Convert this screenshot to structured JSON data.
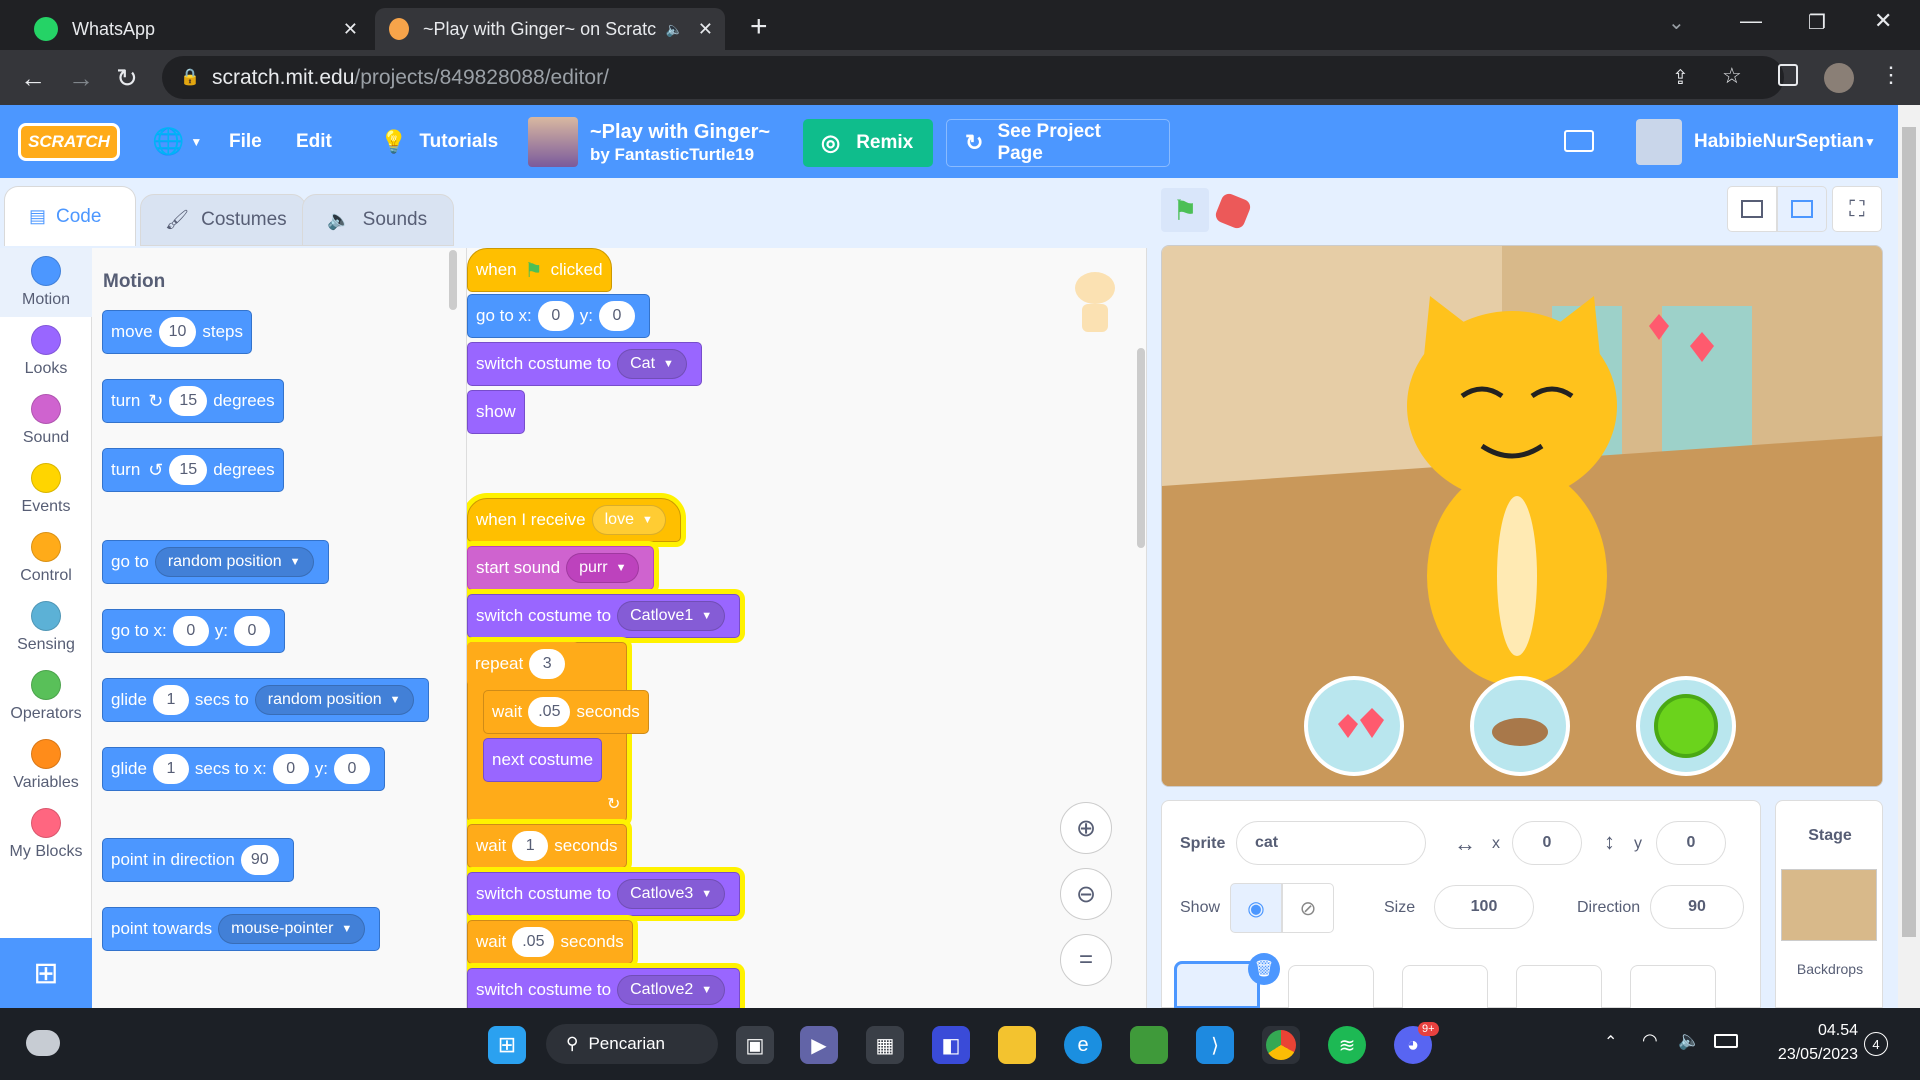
{
  "browser": {
    "tabs": [
      {
        "title": "WhatsApp",
        "icon": "whatsapp-icon"
      },
      {
        "title": "~Play with Ginger~ on Scratc",
        "icon": "scratch-icon"
      }
    ],
    "url_host": "scratch.mit.edu",
    "url_path": "/projects/849828088/editor/"
  },
  "menu": {
    "logo": "SCRATCH",
    "file": "File",
    "edit": "Edit",
    "tutorials": "Tutorials",
    "project_title": "~Play with Ginger~",
    "project_author": "by FantasticTurtle19",
    "remix": "Remix",
    "see_project_page": "See Project Page",
    "username": "HabibieNurSeptian"
  },
  "editor_tabs": {
    "code": "Code",
    "costumes": "Costumes",
    "sounds": "Sounds"
  },
  "categories": [
    {
      "label": "Motion",
      "color": "#4c97ff"
    },
    {
      "label": "Looks",
      "color": "#9966ff"
    },
    {
      "label": "Sound",
      "color": "#cf63cf"
    },
    {
      "label": "Events",
      "color": "#ffd500"
    },
    {
      "label": "Control",
      "color": "#ffab19"
    },
    {
      "label": "Sensing",
      "color": "#5cb1d6"
    },
    {
      "label": "Operators",
      "color": "#59c059"
    },
    {
      "label": "Variables",
      "color": "#ff8c1a"
    },
    {
      "label": "My Blocks",
      "color": "#ff6680"
    }
  ],
  "palette": {
    "heading": "Motion",
    "move": {
      "a": "move",
      "n": "10",
      "b": "steps"
    },
    "turn_cw": {
      "a": "turn",
      "n": "15",
      "b": "degrees"
    },
    "turn_ccw": {
      "a": "turn",
      "n": "15",
      "b": "degrees"
    },
    "goto": {
      "a": "go to",
      "d": "random position"
    },
    "gotoxy": {
      "a": "go to x:",
      "x": "0",
      "y_lbl": "y:",
      "y": "0"
    },
    "glide": {
      "a": "glide",
      "n": "1",
      "b": "secs to",
      "d": "random position"
    },
    "glidexy": {
      "a": "glide",
      "n": "1",
      "b": "secs to x:",
      "x": "0",
      "y_lbl": "y:",
      "y": "0"
    },
    "point_dir": {
      "a": "point in direction",
      "n": "90"
    },
    "point_towards": {
      "a": "point towards",
      "d": "mouse-pointer"
    }
  },
  "script1": {
    "hat_a": "when",
    "hat_b": "clicked",
    "gotoxy": {
      "a": "go to x:",
      "x": "0",
      "y_lbl": "y:",
      "y": "0"
    },
    "costume": {
      "a": "switch costume to",
      "d": "Cat"
    },
    "show": "show"
  },
  "script2": {
    "hat": {
      "a": "when I receive",
      "d": "love"
    },
    "sound": {
      "a": "start sound",
      "d": "purr"
    },
    "costume1": {
      "a": "switch costume to",
      "d": "Catlove1"
    },
    "repeat": {
      "a": "repeat",
      "n": "3"
    },
    "wait_inner": {
      "a": "wait",
      "n": ".05",
      "b": "seconds"
    },
    "next_costume": "next costume",
    "wait1": {
      "a": "wait",
      "n": "1",
      "b": "seconds"
    },
    "costume3": {
      "a": "switch costume to",
      "d": "Catlove3"
    },
    "wait2": {
      "a": "wait",
      "n": ".05",
      "b": "seconds"
    },
    "costume2": {
      "a": "switch costume to",
      "d": "Catlove2"
    }
  },
  "sprite_info": {
    "sprite_lbl": "Sprite",
    "sprite_name": "cat",
    "x_lbl": "x",
    "x": "0",
    "y_lbl": "y",
    "y": "0",
    "show_lbl": "Show",
    "size_lbl": "Size",
    "size": "100",
    "direction_lbl": "Direction",
    "direction": "90"
  },
  "stage_panel": {
    "title": "Stage",
    "backdrops": "Backdrops"
  },
  "taskbar": {
    "search": "Pencarian",
    "time": "04.54",
    "date": "23/05/2023",
    "notif_count": "4",
    "discord_badge": "9+"
  }
}
